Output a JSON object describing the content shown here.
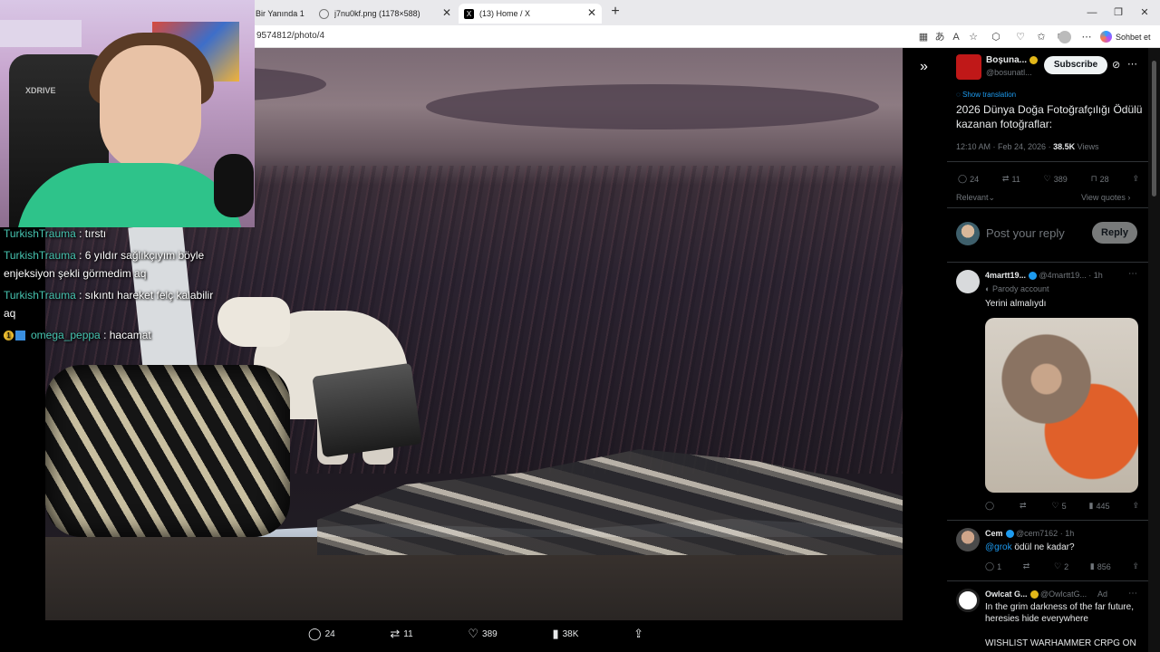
{
  "browser": {
    "tabs": [
      {
        "title": "Bir Yanında 1:"
      },
      {
        "title": "j7nu0kf.png (1178×588)"
      },
      {
        "title": "(13) Home / X"
      }
    ],
    "url_fragment": "9574812/photo/4",
    "copilot_label": "Sohbet et"
  },
  "chat": {
    "messages": [
      {
        "user": "TurkishTrauma",
        "text": " : tırstı"
      },
      {
        "user": "TurkishTrauma",
        "text": " : 6 yıldır sağlıkçıyım böyle enjeksiyon şekli görmedim aq"
      },
      {
        "user": "TurkishTrauma",
        "text": " : sıkıntı hareket felç kalabilir aq"
      },
      {
        "user": "omega_peppa",
        "text": " : hacamat",
        "badge": "1"
      }
    ]
  },
  "photo_actions": {
    "replies": "24",
    "reposts": "11",
    "likes": "389",
    "views": "38K"
  },
  "post": {
    "author_name": "Boşuna...",
    "author_handle": "@bosunatl...",
    "subscribe_label": "Subscribe",
    "show_translation": "Show translation",
    "text": "2026 Dünya Doğa Fotoğrafçılığı Ödülü kazanan fotoğraflar:",
    "timestamp": "12:10 AM · Feb 24, 2026 · ",
    "views_count": "38.5K",
    "views_label": " Views",
    "replies": "24",
    "reposts": "11",
    "likes": "389",
    "bookmarks": "28",
    "sort_label": "Relevant",
    "view_quotes": "View quotes"
  },
  "composer": {
    "placeholder": "Post your reply",
    "reply_label": "Reply"
  },
  "replies": [
    {
      "name": "4martt19...",
      "handle": "@4martt19...",
      "time": "· 1h",
      "tag": "Parody account",
      "text": "Yerini almalıydı",
      "replies": "",
      "reposts": "",
      "likes": "5",
      "views": "445"
    },
    {
      "name": "Cem",
      "handle": "@cem7162",
      "time": "· 1h",
      "mention": "@grok",
      "text": " ödül ne kadar?",
      "replies": "1",
      "reposts": "",
      "likes": "2",
      "views": "856"
    },
    {
      "name": "Owlcat G...",
      "handle": "@OwlcatG...",
      "ad": "Ad",
      "text": "In the grim darkness of the far future, heresies hide everywhere",
      "text2": "WISHLIST WARHAMMER CRPG ON"
    }
  ]
}
